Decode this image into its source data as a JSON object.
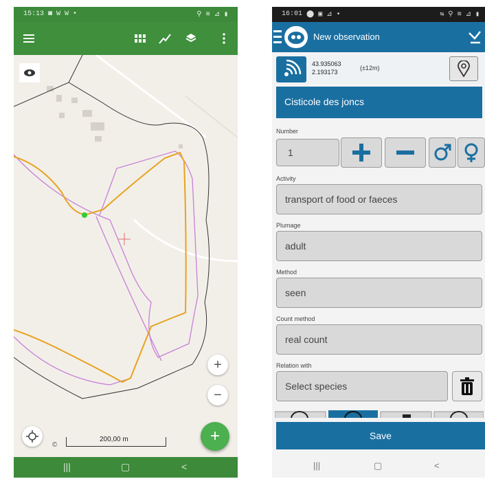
{
  "map_app": {
    "status": {
      "time": "15:13",
      "left_icons": "◙ W W •",
      "right_icons": "⚲ ≋ ⊿ ▮"
    },
    "toolbar": {
      "menu_icon": "hamburger-icon",
      "actions": [
        "grid-icon",
        "draw-line-icon",
        "layers-icon",
        "more-vert-icon"
      ]
    },
    "map": {
      "visibility_icon": "eye-icon",
      "zoom_in": "+",
      "zoom_out": "−",
      "fab": "+",
      "copyright": "©",
      "scale_label": "200,00 m",
      "colors": {
        "track": "#e8a21e",
        "boundary": "#c77fd6",
        "outline": "#333333",
        "point": "#33cc33"
      }
    },
    "nav": {
      "recent": "|||",
      "home": "▢",
      "back": "<"
    }
  },
  "obs_app": {
    "status": {
      "time": "16:01",
      "left_icons": "⬤ ▣ ⊿ •",
      "right_icons": "⇆ ⚲ ≋ ⊿ ▮"
    },
    "header": {
      "title": "New observation"
    },
    "gps": {
      "lat": "43.935063",
      "lon": "2.193173",
      "accuracy": "(±12m)"
    },
    "species": "Cisticole des joncs",
    "number": {
      "label": "Number",
      "value": "1"
    },
    "activity": {
      "label": "Activity",
      "value": "transport of food or faeces"
    },
    "plumage": {
      "label": "Plumage",
      "value": "adult"
    },
    "method": {
      "label": "Method",
      "value": "seen"
    },
    "count_method": {
      "label": "Count method",
      "value": "real count"
    },
    "relation": {
      "label": "Relation with",
      "value": "Select species"
    },
    "save": "Save",
    "nav": {
      "recent": "|||",
      "home": "▢",
      "back": "<"
    },
    "colors": {
      "primary": "#1a6fa1",
      "field_bg": "#d9d9d9"
    }
  }
}
